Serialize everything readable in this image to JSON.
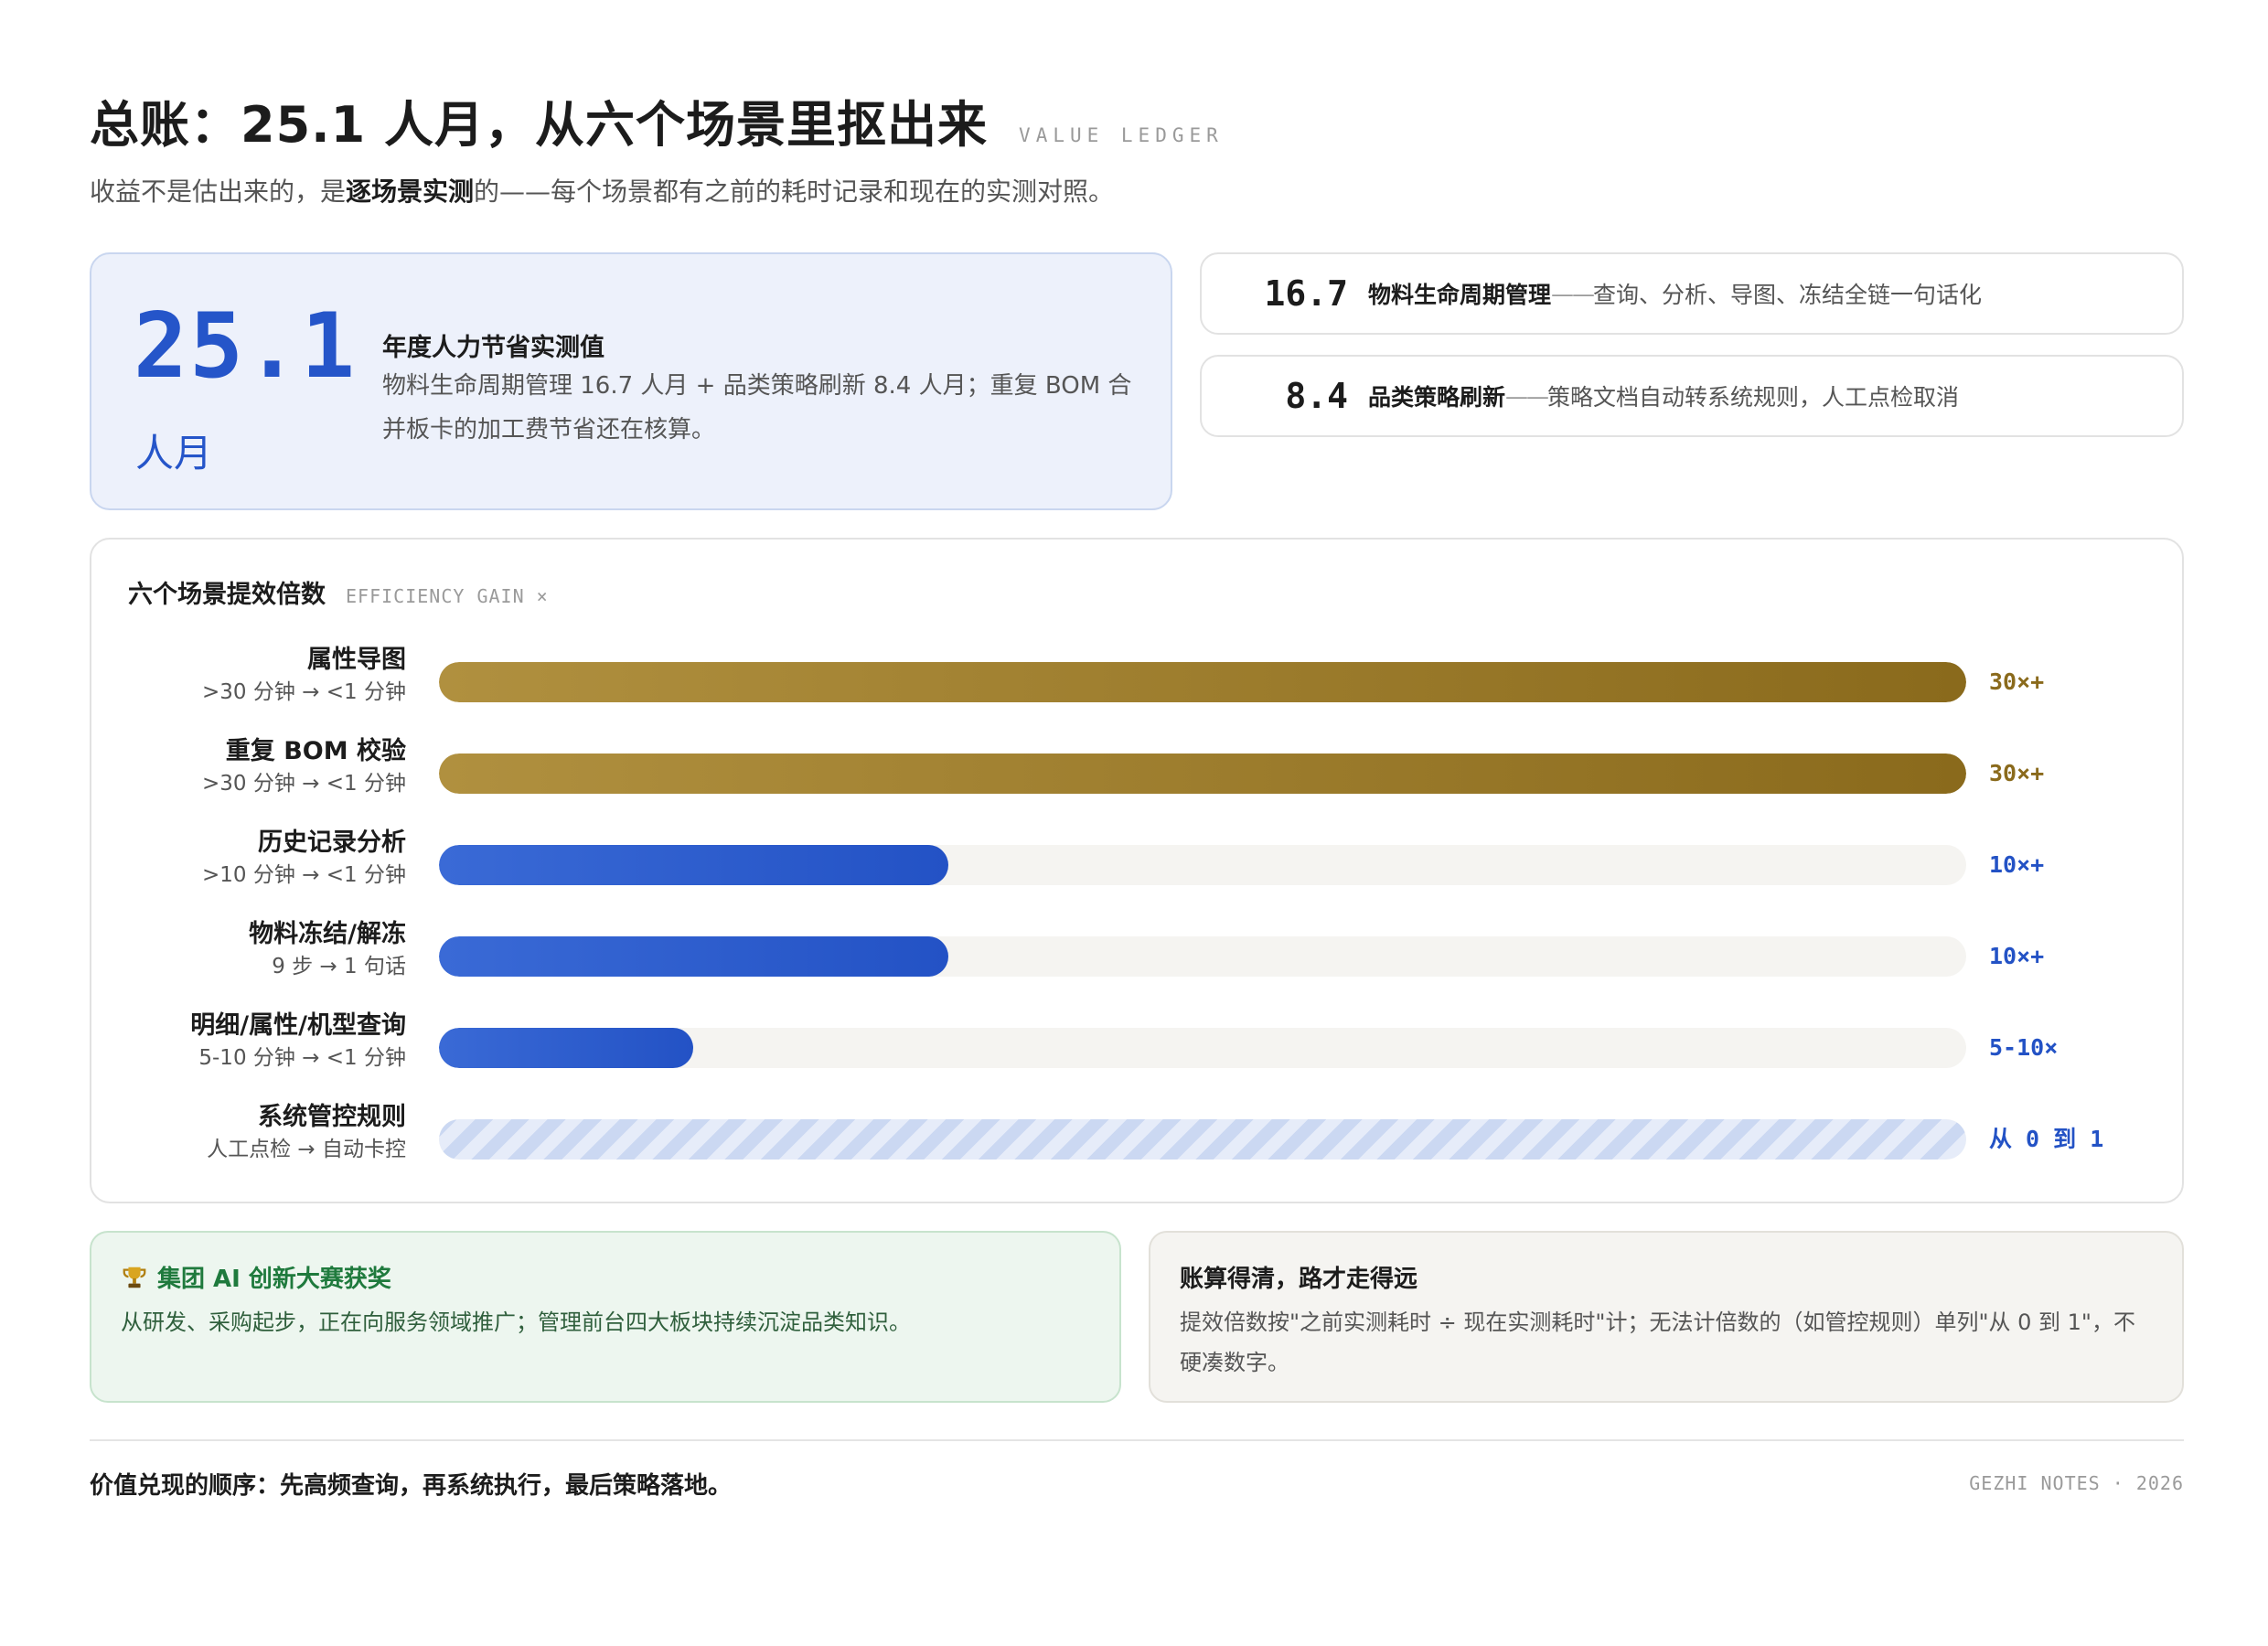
{
  "header": {
    "title": "总账：25.1 人月，从六个场景里抠出来",
    "tag": "VALUE LEDGER",
    "subtitle_pre": "收益不是估出来的，是",
    "subtitle_bold": "逐场景实测",
    "subtitle_post": "的——每个场景都有之前的耗时记录和现在的实测对照。"
  },
  "summary": {
    "value": "25.1",
    "unit": "人月",
    "label": "年度人力节省实测值",
    "desc": "物料生命周期管理 16.7 人月 + 品类策略刷新 8.4 人月；重复 BOM 合并板卡的加工费节省还在核算。"
  },
  "stats": [
    {
      "value": "16.7",
      "name": "物料生命周期管理",
      "dash": "——",
      "desc": "查询、分析、导图、冻结全链一句话化"
    },
    {
      "value": "8.4",
      "name": "品类策略刷新",
      "dash": "——",
      "desc": "策略文档自动转系统规则，人工点检取消"
    }
  ],
  "chart_data": {
    "type": "bar",
    "orientation": "horizontal",
    "title": "六个场景提效倍数",
    "title_tag": "EFFICIENCY GAIN ×",
    "categories": [
      "属性导图",
      "重复 BOM 校验",
      "历史记录分析",
      "物料冻结/解冻",
      "明细/属性/机型查询",
      "系统管控规则"
    ],
    "subtitles": [
      ">30 分钟 → <1 分钟",
      ">30 分钟 → <1 分钟",
      ">10 分钟 → <1 分钟",
      "9 步 → 1 句话",
      "5-10 分钟 → <1 分钟",
      "人工点检 → 自动卡控"
    ],
    "values": [
      30,
      30,
      10,
      10,
      5,
      null
    ],
    "value_labels": [
      "30×+",
      "30×+",
      "10×+",
      "10×+",
      "5-10×",
      "从 0 到 1"
    ],
    "styles": [
      "gold",
      "gold",
      "blue",
      "blue",
      "blue",
      "hatch"
    ],
    "colors": {
      "gold": "#8a6a1c",
      "blue": "#2352c5",
      "track": "#f5f4f1",
      "hatch": "#cbd8f2"
    }
  },
  "notes": {
    "award": {
      "title": "集团 AI 创新大赛获奖",
      "icon": "trophy-icon",
      "body": "从研发、采购起步，正在向服务领域推广；管理前台四大板块持续沉淀品类知识。"
    },
    "method": {
      "title": "账算得清，路才走得远",
      "body": "提效倍数按\"之前实测耗时 ÷ 现在实测耗时\"计；无法计倍数的（如管控规则）单列\"从 0 到 1\"，不硬凑数字。"
    }
  },
  "footer": {
    "left": "价值兑现的顺序：先高频查询，再系统执行，最后策略落地。",
    "right": "GEZHI NOTES · 2026"
  }
}
